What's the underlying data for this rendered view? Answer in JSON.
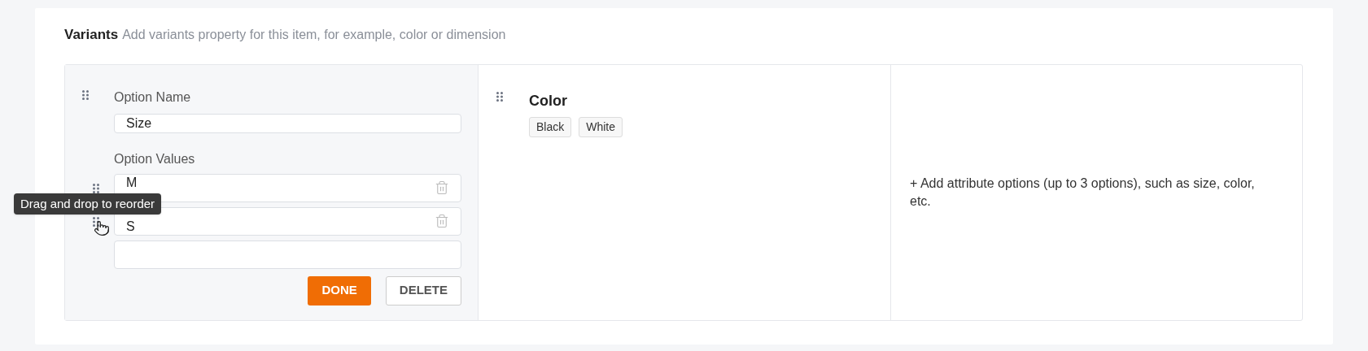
{
  "section": {
    "title": "Variants",
    "description": "Add variants property for this item, for example, color or dimension"
  },
  "options": [
    {
      "kind": "editing",
      "name_label": "Option Name",
      "name": "Size",
      "values_label": "Option Values",
      "values": [
        "M",
        "S"
      ],
      "tooltip": "Drag and drop to reorder",
      "buttons": [
        {
          "label": "DONE",
          "kind": "primary"
        },
        {
          "label": "DELETE",
          "kind": "secondary"
        }
      ]
    },
    {
      "kind": "summary",
      "name": "Color",
      "values": [
        "Black",
        "White"
      ]
    }
  ],
  "add_option": {
    "label": "+ Add attribute options (up to 3 options), such as size, color, etc."
  }
}
